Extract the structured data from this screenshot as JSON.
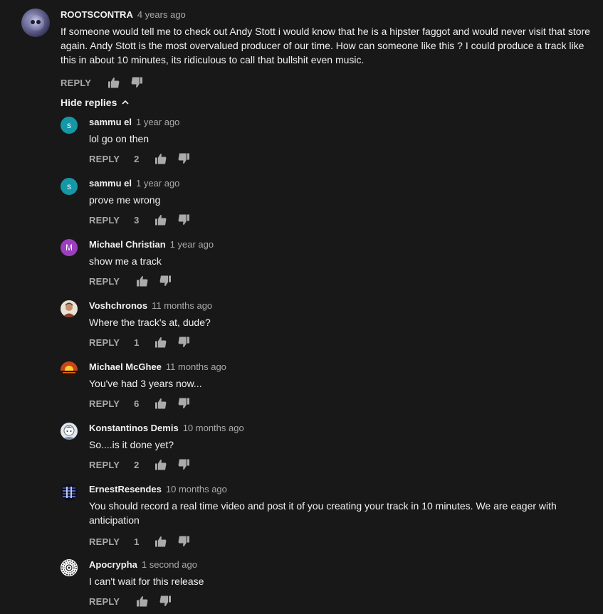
{
  "top_comment": {
    "author": "ROOTSCONTRA",
    "time": "4 years ago",
    "text": "If someone would tell me to check out Andy Stott i would know that he is a hipster faggot and would never visit that store again.  Andy Stott is the most overvalued producer of our time. How can someone like this ? I could produce a track like this in about 10 minutes, its ridiculous to call that bullshit even music.",
    "reply_label": "REPLY",
    "avatar_icon": "alien-avatar-icon"
  },
  "hide_replies_label": "Hide replies",
  "replies": [
    {
      "author": "sammu el",
      "time": "1 year ago",
      "text": "lol go on then",
      "likes": "2",
      "reply_label": "REPLY",
      "avatar_letter": "s",
      "avatar_color": "#1597a6"
    },
    {
      "author": "sammu el",
      "time": "1 year ago",
      "text": "prove me wrong",
      "likes": "3",
      "reply_label": "REPLY",
      "avatar_letter": "s",
      "avatar_color": "#1597a6"
    },
    {
      "author": "Michael Christian",
      "time": "1 year ago",
      "text": "show me a track",
      "likes": "",
      "reply_label": "REPLY",
      "avatar_letter": "M",
      "avatar_color": "#9c3fbf"
    },
    {
      "author": "Voshchronos",
      "time": "11 months ago",
      "text": "Where the track's at, dude?",
      "likes": "1",
      "reply_label": "REPLY",
      "avatar_icon": "portrait-avatar-icon"
    },
    {
      "author": "Michael McGhee",
      "time": "11 months ago",
      "text": "You've had 3 years now...",
      "likes": "6",
      "reply_label": "REPLY",
      "avatar_icon": "sunset-avatar-icon"
    },
    {
      "author": "Konstantinos Demis",
      "time": "10 months ago",
      "text": "So....is it done yet?",
      "likes": "2",
      "reply_label": "REPLY",
      "avatar_icon": "cartoon-avatar-icon"
    },
    {
      "author": "ErnestResendes",
      "time": "10 months ago",
      "text": "You should record a real time video and post it of you creating your track in 10 minutes. We are eager with anticipation",
      "likes": "1",
      "reply_label": "REPLY",
      "avatar_icon": "dark-pattern-avatar-icon"
    },
    {
      "author": "Apocrypha",
      "time": "1 second ago",
      "text": "I can't wait for this release",
      "likes": "",
      "reply_label": "REPLY",
      "avatar_icon": "mandala-avatar-icon"
    }
  ],
  "colors": {
    "background": "#181818",
    "text_primary": "#f1f1f1",
    "text_secondary": "#aaaaaa"
  }
}
